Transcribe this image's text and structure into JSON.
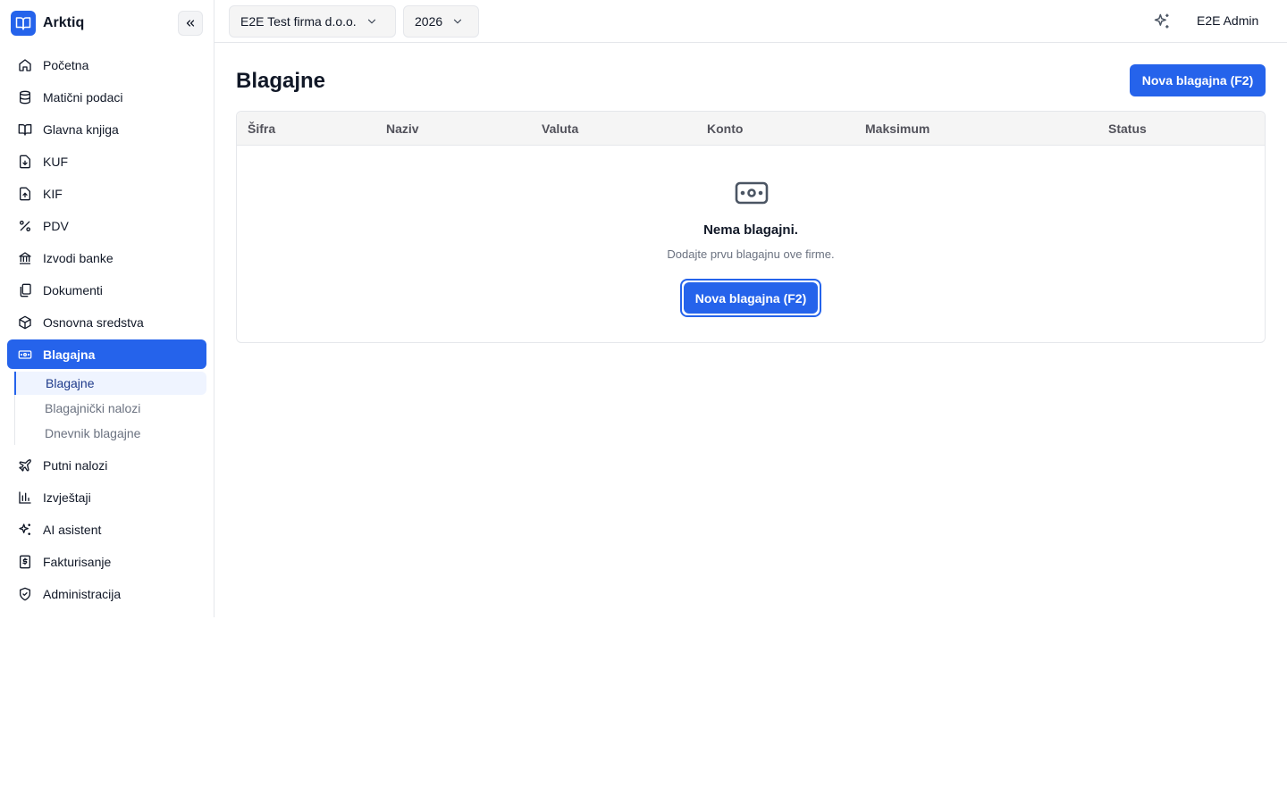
{
  "app": {
    "name": "Arktiq"
  },
  "sidebar": {
    "items": [
      {
        "label": "Početna",
        "icon": "home-icon"
      },
      {
        "label": "Matični podaci",
        "icon": "database-icon"
      },
      {
        "label": "Glavna knjiga",
        "icon": "book-icon"
      },
      {
        "label": "KUF",
        "icon": "file-download-icon"
      },
      {
        "label": "KIF",
        "icon": "file-upload-icon"
      },
      {
        "label": "PDV",
        "icon": "percent-icon"
      },
      {
        "label": "Izvodi banke",
        "icon": "bank-icon"
      },
      {
        "label": "Dokumenti",
        "icon": "documents-icon"
      },
      {
        "label": "Osnovna sredstva",
        "icon": "box-icon"
      },
      {
        "label": "Blagajna",
        "icon": "cash-icon",
        "active": true
      }
    ],
    "subitems": [
      {
        "label": "Blagajne",
        "active": true
      },
      {
        "label": "Blagajnički nalozi"
      },
      {
        "label": "Dnevnik blagajne"
      }
    ],
    "items_after": [
      {
        "label": "Putni nalozi",
        "icon": "plane-icon"
      },
      {
        "label": "Izvještaji",
        "icon": "bar-chart-icon"
      },
      {
        "label": "AI asistent",
        "icon": "sparkles-icon"
      },
      {
        "label": "Fakturisanje",
        "icon": "dollar-file-icon"
      },
      {
        "label": "Administracija",
        "icon": "shield-icon"
      }
    ]
  },
  "topbar": {
    "company": "E2E Test firma d.o.o.",
    "year": "2026",
    "user": "E2E Admin"
  },
  "page": {
    "title": "Blagajne",
    "new_button": "Nova blagajna (F2)"
  },
  "table": {
    "columns": [
      "Šifra",
      "Naziv",
      "Valuta",
      "Konto",
      "Maksimum",
      "Status"
    ]
  },
  "empty": {
    "title": "Nema blagajni.",
    "subtitle": "Dodajte prvu blagajnu ove firme.",
    "button": "Nova blagajna (F2)"
  },
  "colors": {
    "accent": "#2563eb",
    "accent_soft": "#eff4ff"
  }
}
